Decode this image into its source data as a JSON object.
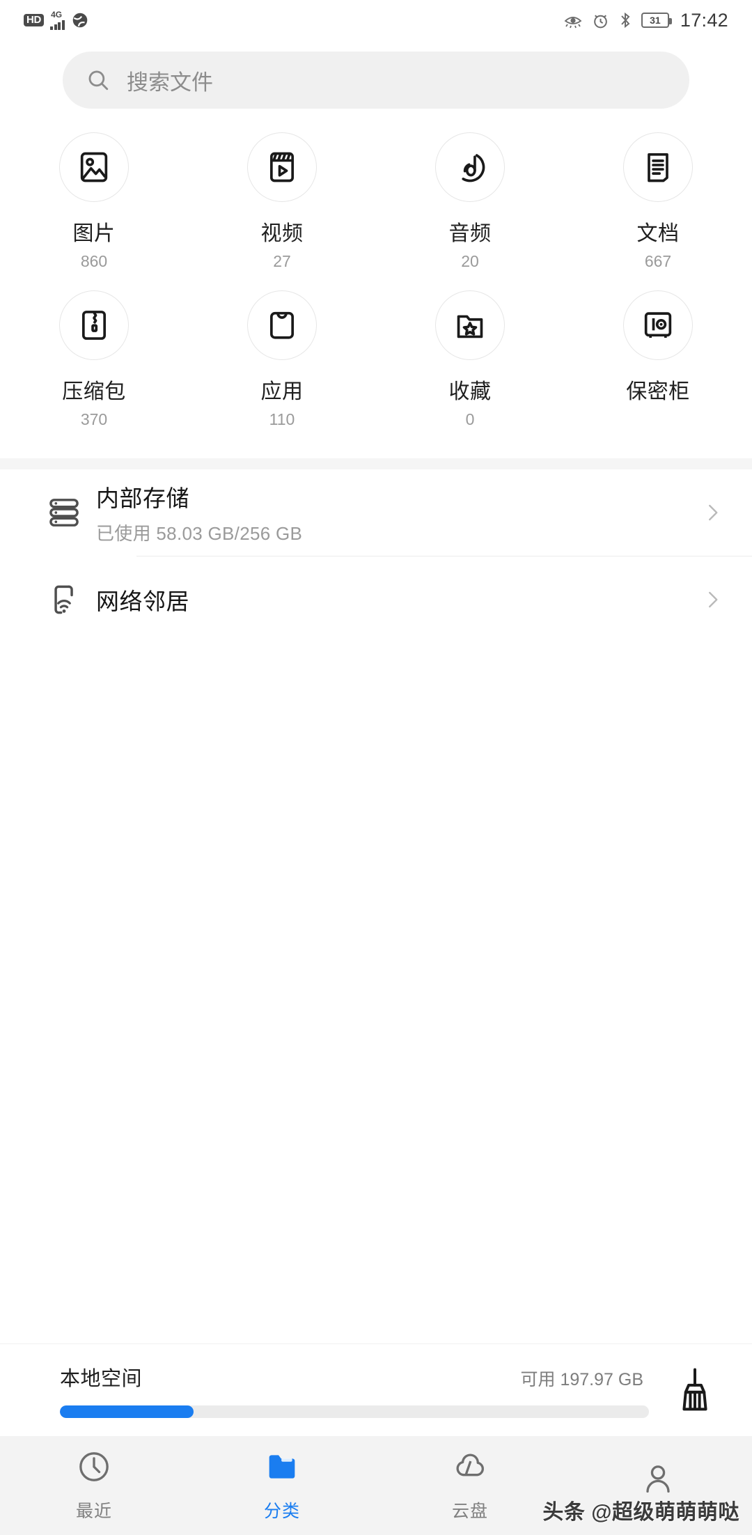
{
  "statusbar": {
    "hd_label": "HD",
    "network_gen": "4G",
    "signal_icon": "signal-bars-icon",
    "globe_icon": "globe-icon",
    "eye_comfort_icon": "eye-comfort-icon",
    "alarm_icon": "alarm-clock-icon",
    "bluetooth_icon": "bluetooth-icon",
    "battery_level": "31",
    "time": "17:42"
  },
  "search": {
    "icon": "search-icon",
    "placeholder": "搜索文件",
    "value": ""
  },
  "categories": {
    "row1": [
      {
        "icon": "image-icon",
        "label": "图片",
        "count": "860"
      },
      {
        "icon": "video-icon",
        "label": "视频",
        "count": "27"
      },
      {
        "icon": "audio-icon",
        "label": "音频",
        "count": "20"
      },
      {
        "icon": "document-icon",
        "label": "文档",
        "count": "667"
      }
    ],
    "row2": [
      {
        "icon": "archive-icon",
        "label": "压缩包",
        "count": "370"
      },
      {
        "icon": "app-bag-icon",
        "label": "应用",
        "count": "110"
      },
      {
        "icon": "favorite-folder-icon",
        "label": "收藏",
        "count": "0"
      },
      {
        "icon": "safe-box-icon",
        "label": "保密柜",
        "count": ""
      }
    ]
  },
  "storage_list": [
    {
      "icon": "internal-storage-icon",
      "title": "内部存储",
      "subtitle": "已使用 58.03 GB/256 GB",
      "chevron": "chevron-right-icon"
    },
    {
      "icon": "network-neighbor-icon",
      "title": "网络邻居",
      "subtitle": "",
      "chevron": "chevron-right-icon"
    }
  ],
  "local_space": {
    "title": "本地空间",
    "free_text": "可用 197.97 GB",
    "progress_percent": 22.7,
    "bar_color": "#1a7df0",
    "clean_icon": "broom-icon"
  },
  "bottom_nav": {
    "active_color": "#1a7df0",
    "items": [
      {
        "icon": "clock-icon",
        "label": "最近",
        "active": false
      },
      {
        "icon": "folder-icon",
        "label": "分类",
        "active": true
      },
      {
        "icon": "cloud-icon",
        "label": "云盘",
        "active": false
      },
      {
        "icon": "person-icon",
        "label": "",
        "active": false
      }
    ]
  },
  "watermark": {
    "text": "头条 @超级萌萌萌哒"
  }
}
